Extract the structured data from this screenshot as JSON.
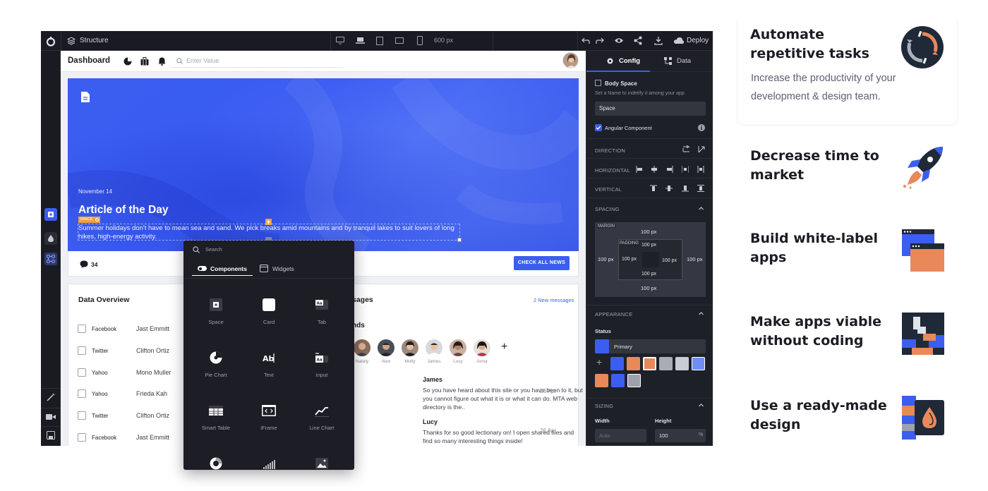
{
  "topbar": {
    "structure_label": "Structure",
    "width_label": "600 px",
    "deploy_label": "Deploy"
  },
  "canvas": {
    "header": {
      "title": "Dashboard",
      "search_placeholder": "Enter Value"
    },
    "hero": {
      "date": "November 14",
      "title": "Article of the Day",
      "tag_label": "SPACE",
      "body": "Summer holidays don't have to mean sea and sand. We pick breaks amid mountains and by tranquil lakes to suit lovers of long hikes, high-energy activity.",
      "comment_count": "34",
      "cta_label": "CHECK ALL NEWS"
    },
    "data_overview": {
      "title": "Data Overview",
      "rows": [
        {
          "source": "Facebook",
          "name": "Jast Emmitt"
        },
        {
          "source": "Twitter",
          "name": "Clifton Ortiz"
        },
        {
          "source": "Yahoo",
          "name": "Mono Muller"
        },
        {
          "source": "Yahoo",
          "name": "Frieda Kah"
        },
        {
          "source": "Twitter",
          "name": "Clifton Ortiz"
        },
        {
          "source": "Facebook",
          "name": "Jast Emmitt"
        }
      ]
    },
    "messages": {
      "title_partial": "sages",
      "new_link": "2 New messages",
      "friends_partial": "nds",
      "friends": [
        "Nataly",
        "Alex",
        "Molly",
        "James",
        "Lucy",
        "Anna"
      ],
      "add_symbol": "+",
      "items": [
        {
          "name": "James",
          "text": "So you have heard about this site or you have been to it, but you cannot figure out what it is or what it can do. MTA web directory is the..",
          "date": "26 Apr"
        },
        {
          "name": "Lucy",
          "text": "Thanks for so good lectionary on! I open shared files and find so many interesting things inside!",
          "date": "26 Apr"
        }
      ]
    }
  },
  "popup": {
    "search_placeholder": "Search",
    "tabs": [
      {
        "label": "Components",
        "active": true
      },
      {
        "label": "Widgets",
        "active": false
      }
    ],
    "items": [
      "Space",
      "Card",
      "Tab",
      "Pie Chart",
      "Text",
      "Input",
      "Smart Table",
      "iFrame",
      "Line Chart"
    ]
  },
  "panel": {
    "tabs": [
      {
        "label": "Config",
        "active": true
      },
      {
        "label": "Data",
        "active": false
      }
    ],
    "component_name": "Body Space",
    "name_hint": "Set a Name to indetify it among your app",
    "name_value": "Space",
    "angular_label": "Angular Component",
    "direction_label": "DIRECTION",
    "horizontal_label": "HORIZONTAL",
    "vertical_label": "VERTICAL",
    "spacing_label": "SPACING",
    "margin_label": "MARGIN",
    "padding_label": "PADDING",
    "px_value": "100 px",
    "appearance_label": "APPEARANCE",
    "status_label": "Status",
    "status_value": "Primary",
    "sizing_label": "SIZING",
    "width_label": "Width",
    "height_label": "Height",
    "width_value": "Auto",
    "height_value": "100",
    "height_unit": "%",
    "swatches": [
      "#3b5ef0",
      "#e8895a",
      "#e8895a",
      "#a9adb6",
      "#c9ccd3",
      "#6f8ff5",
      "#e8895a",
      "#3b5ef0",
      "#9ea1ad"
    ]
  },
  "features": [
    {
      "title": "Automate repetitive tasks",
      "desc": "Increase the productivity of your development & design team."
    },
    {
      "title": "Decrease time to market"
    },
    {
      "title": "Build white-label apps"
    },
    {
      "title": "Make apps viable without coding"
    },
    {
      "title": "Use a ready-made design"
    }
  ],
  "colors": {
    "accent": "#3b5ef0",
    "orange": "#e8895a",
    "dark": "#1a1b22"
  }
}
